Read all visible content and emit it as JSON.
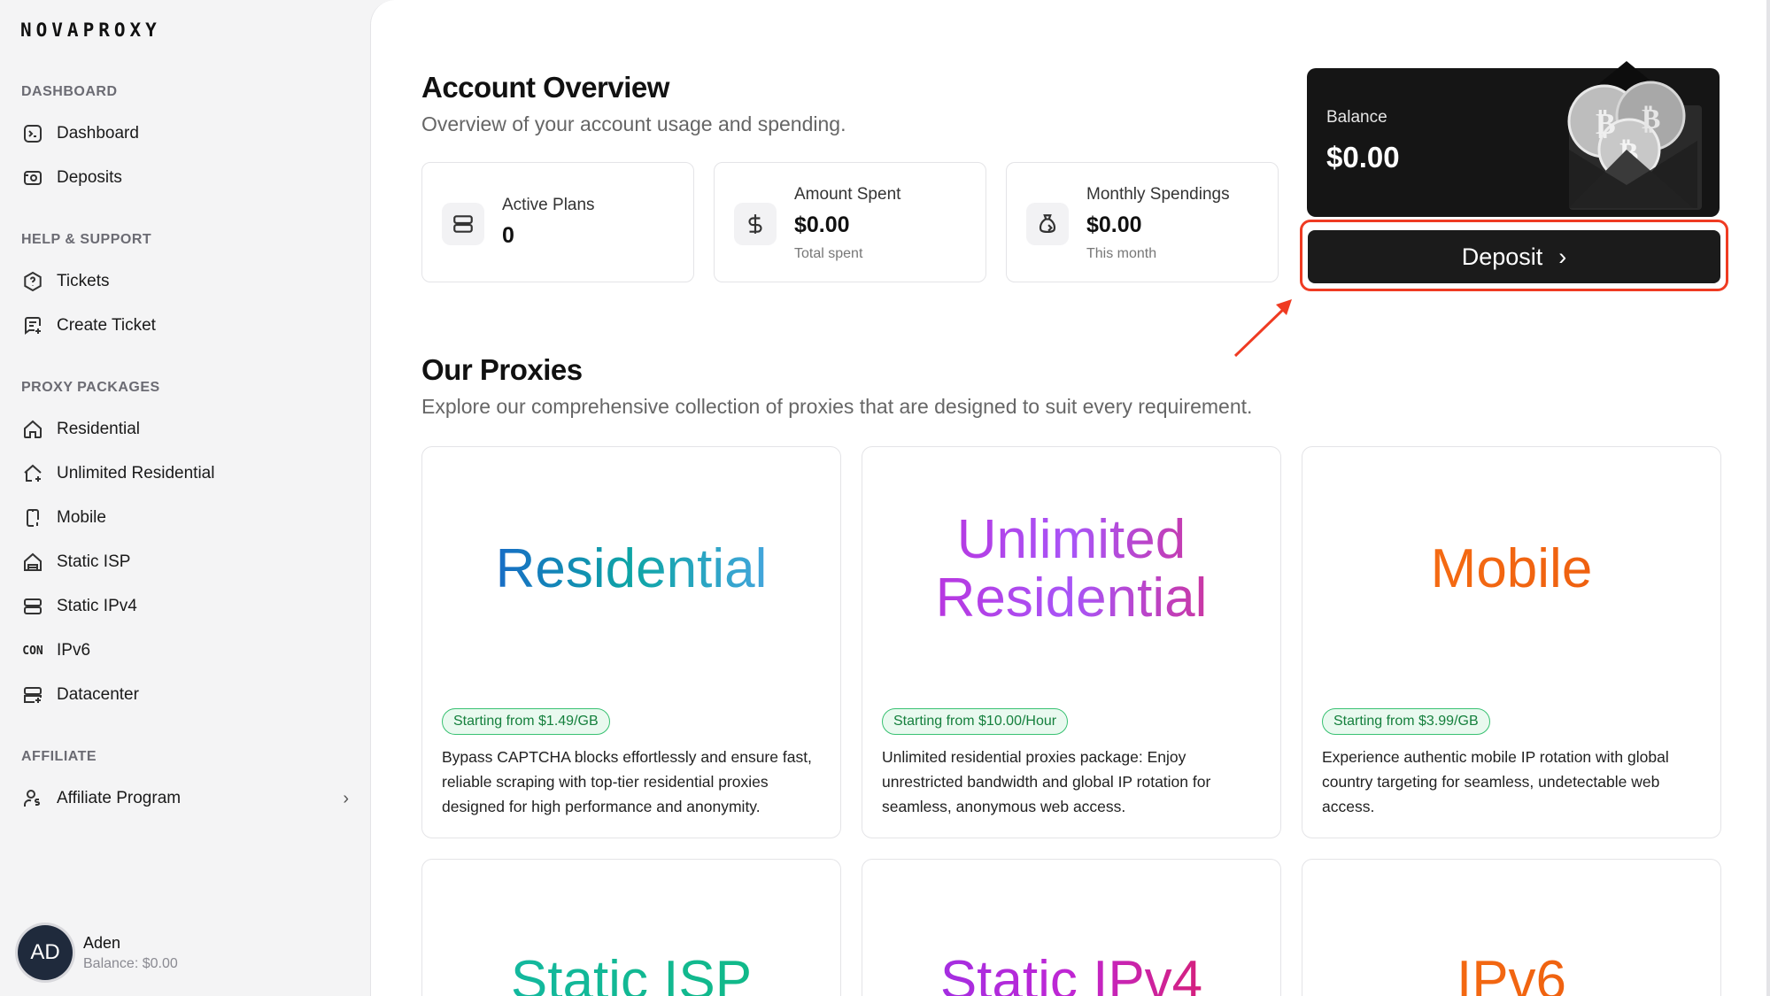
{
  "brand": {
    "logo": "NOVAPROXY"
  },
  "sidebar": {
    "sections": [
      {
        "title": "DASHBOARD",
        "items": [
          {
            "label": "Dashboard",
            "icon": "terminal-icon"
          },
          {
            "label": "Deposits",
            "icon": "wallet-icon"
          }
        ]
      },
      {
        "title": "HELP & SUPPORT",
        "items": [
          {
            "label": "Tickets",
            "icon": "help-circle-icon"
          },
          {
            "label": "Create Ticket",
            "icon": "message-plus-icon"
          }
        ]
      },
      {
        "title": "PROXY PACKAGES",
        "items": [
          {
            "label": "Residential",
            "icon": "home-icon"
          },
          {
            "label": "Unlimited Residential",
            "icon": "home-plus-icon"
          },
          {
            "label": "Mobile",
            "icon": "mobile-icon"
          },
          {
            "label": "Static ISP",
            "icon": "building-icon"
          },
          {
            "label": "Static IPv4",
            "icon": "server-icon"
          },
          {
            "label": "IPv6",
            "icon": "con-icon",
            "mark": "CON"
          },
          {
            "label": "Datacenter",
            "icon": "server-plus-icon"
          }
        ]
      },
      {
        "title": "AFFILIATE",
        "items": [
          {
            "label": "Affiliate Program",
            "icon": "user-dollar-icon"
          }
        ]
      }
    ],
    "user": {
      "initials": "AD",
      "name": "Aden",
      "balance": "Balance: $0.00"
    }
  },
  "overview": {
    "title": "Account Overview",
    "subtitle": "Overview of your account usage and spending.",
    "stats": [
      {
        "label": "Active Plans",
        "value": "0",
        "note": ""
      },
      {
        "label": "Amount Spent",
        "value": "$0.00",
        "note": "Total spent"
      },
      {
        "label": "Monthly Spendings",
        "value": "$0.00",
        "note": "This month"
      }
    ],
    "balance": {
      "label": "Balance",
      "value": "$0.00"
    },
    "deposit_label": "Deposit",
    "deposit_chevron": "›"
  },
  "proxies": {
    "title": "Our Proxies",
    "subtitle": "Explore our comprehensive collection of proxies that are designed to suit every requirement.",
    "cards": [
      {
        "title": "Residential",
        "badge": "Starting from $1.49/GB",
        "desc": "Bypass CAPTCHA blocks effortlessly and ensure fast, reliable scraping with top-tier residential proxies designed for high performance and anonymity."
      },
      {
        "title_line1": "Unlimited",
        "title_line2": "Residential",
        "badge": "Starting from $10.00/Hour",
        "desc": "Unlimited residential proxies package: Enjoy unrestricted bandwidth and global IP rotation for seamless, anonymous web access."
      },
      {
        "title": "Mobile",
        "badge": "Starting from $3.99/GB",
        "desc": "Experience authentic mobile IP rotation with global country targeting for seamless, undetectable web access."
      },
      {
        "title": "Static ISP"
      },
      {
        "title": "Static IPv4"
      },
      {
        "title": "IPv6"
      }
    ]
  },
  "colors": {
    "accent": "#ef3b22",
    "badge_green": "#15803d",
    "dark_card": "#151515"
  }
}
